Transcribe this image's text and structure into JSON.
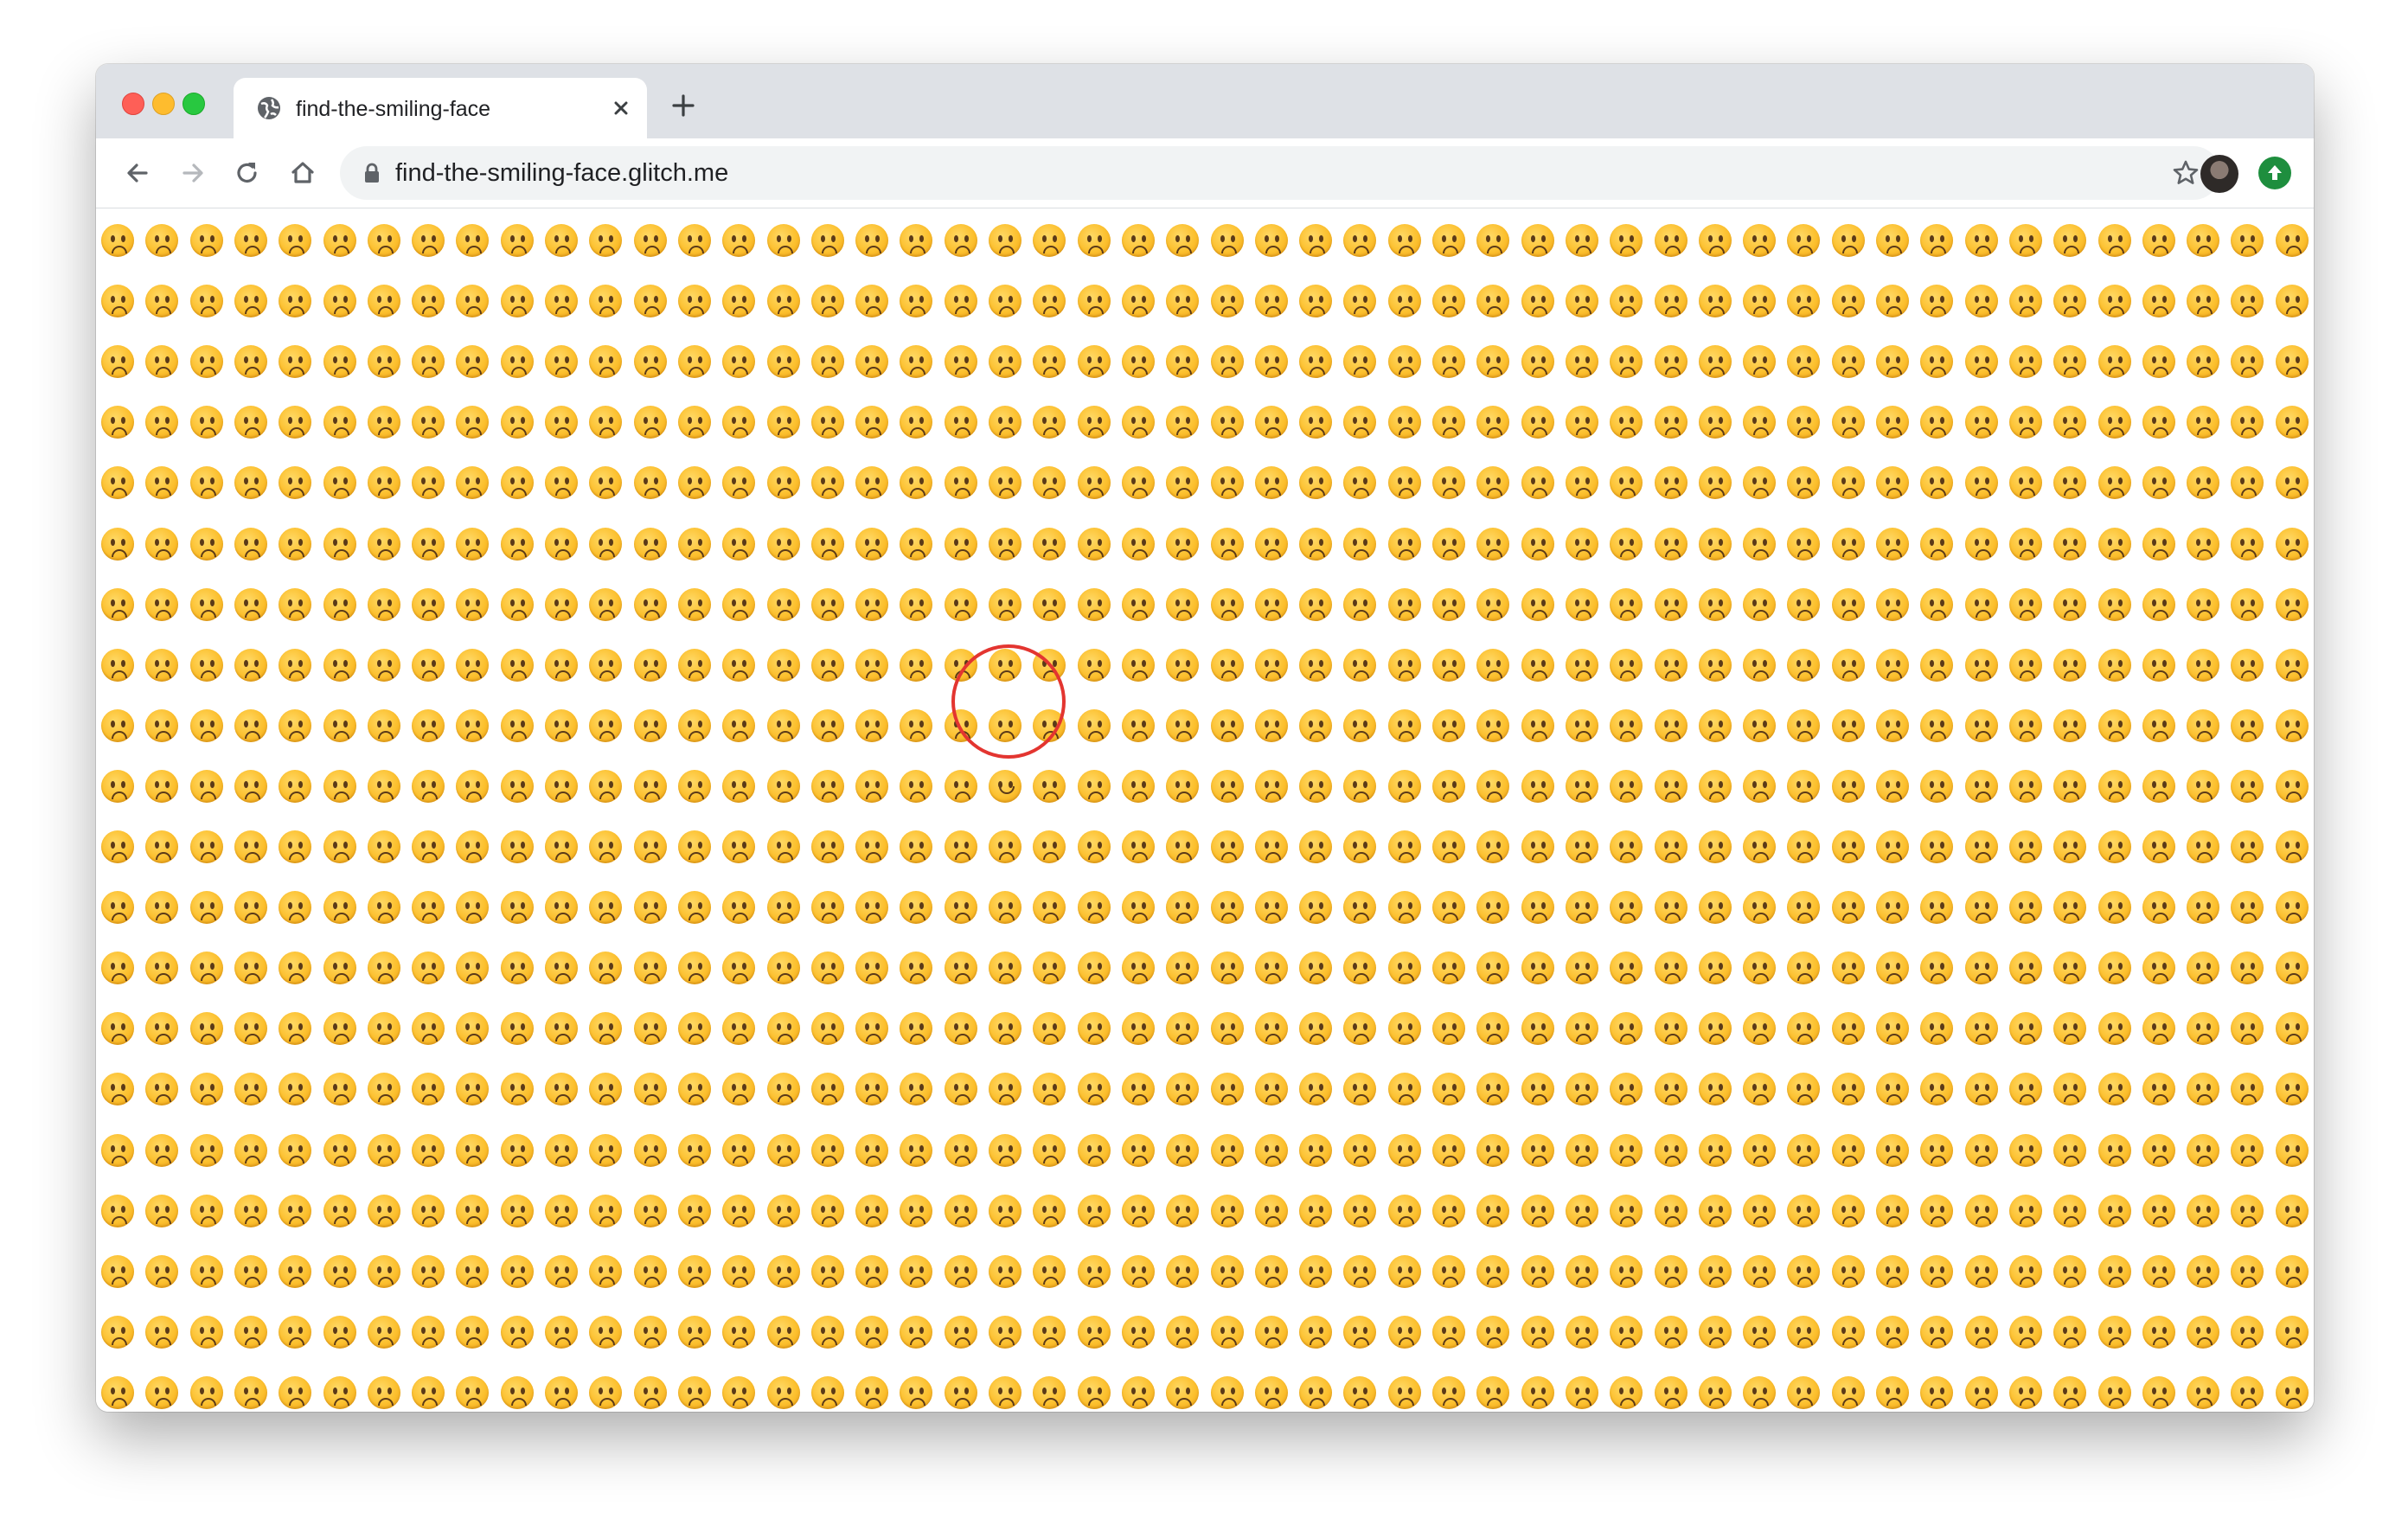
{
  "browser": {
    "tab": {
      "title": "find-the-smiling-face",
      "favicon": "globe-icon"
    },
    "toolbar": {
      "back": "back-arrow-icon",
      "forward": "forward-arrow-icon",
      "reload": "reload-icon",
      "home": "home-icon"
    },
    "omnibox": {
      "url": "find-the-smiling-face.glitch.me",
      "lock_icon": "lock-icon",
      "bookmark_icon": "star-icon"
    },
    "profile_icon": "avatar",
    "extension_icon": "green-extension-icon"
  },
  "grid": {
    "columns": 50,
    "rows": 20,
    "default_emoji": "slightly-frowning-face",
    "target_emoji": "slightly-smiling-face",
    "target_row": 9,
    "target_col": 20
  },
  "colors": {
    "face": "#fcc02e",
    "highlight": "#e33530",
    "tabstrip": "#dee1e6"
  }
}
